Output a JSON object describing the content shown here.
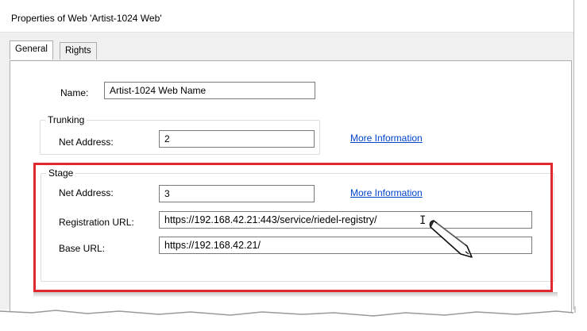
{
  "window": {
    "title": "Properties of Web 'Artist-1024 Web'"
  },
  "tabs": [
    {
      "label": "General",
      "active": true
    },
    {
      "label": "Rights",
      "active": false
    }
  ],
  "general": {
    "name_label": "Name:",
    "name_value": "Artist-1024 Web Name"
  },
  "trunking": {
    "title": "Trunking",
    "net_address_label": "Net Address:",
    "net_address_value": "2",
    "more_info": "More Information"
  },
  "stage": {
    "title": "Stage",
    "net_address_label": "Net Address:",
    "net_address_value": "3",
    "more_info": "More Information",
    "registration_url_label": "Registration URL:",
    "registration_url_value": "https://192.168.42.21:443/service/riedel-registry/",
    "base_url_label": "Base URL:",
    "base_url_value": "https://192.168.42.21/"
  },
  "colors": {
    "highlight": "#e0282e",
    "link": "#0044cc"
  },
  "icons": {
    "cursor": "pen-pointer-icon",
    "text_cursor": "i-beam-icon"
  }
}
